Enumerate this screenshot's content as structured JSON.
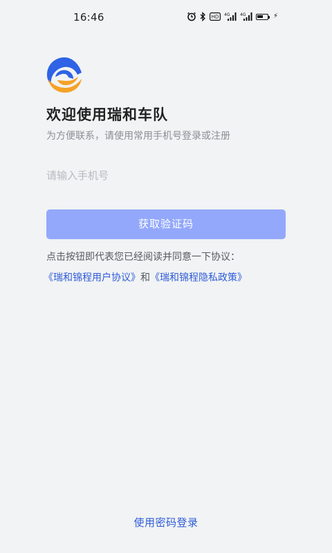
{
  "status_bar": {
    "time": "16:46",
    "icons": [
      "alarm-icon",
      "bluetooth-icon",
      "hd-icon",
      "4g-signal-icon",
      "4g-signal-icon",
      "battery-icon",
      "charging-icon"
    ],
    "hd_label": "HD",
    "net1_label": "4G",
    "net2_label": "4G",
    "charging_glyph": "⚡"
  },
  "brand": {
    "logo_icon": "ruihe-logo-icon",
    "accent_color": "#2f5bd8",
    "logo_colors": [
      "#2e63e6",
      "#f5a227"
    ]
  },
  "header": {
    "title": "欢迎使用瑞和车队",
    "subtitle": "为方便联系，请使用常用手机号登录或注册"
  },
  "form": {
    "phone_placeholder": "请输入手机号",
    "phone_value": "",
    "get_code_label": "获取验证码",
    "button_color": "#93a8fb"
  },
  "agreement": {
    "prefix_text": "点击按钮即代表您已经阅读并同意一下协议：",
    "user_agreement": "《瑞和锦程用户协议》",
    "joiner": "和",
    "privacy_policy": "《瑞和锦程隐私政策》"
  },
  "footer": {
    "password_login_label": "使用密码登录"
  }
}
